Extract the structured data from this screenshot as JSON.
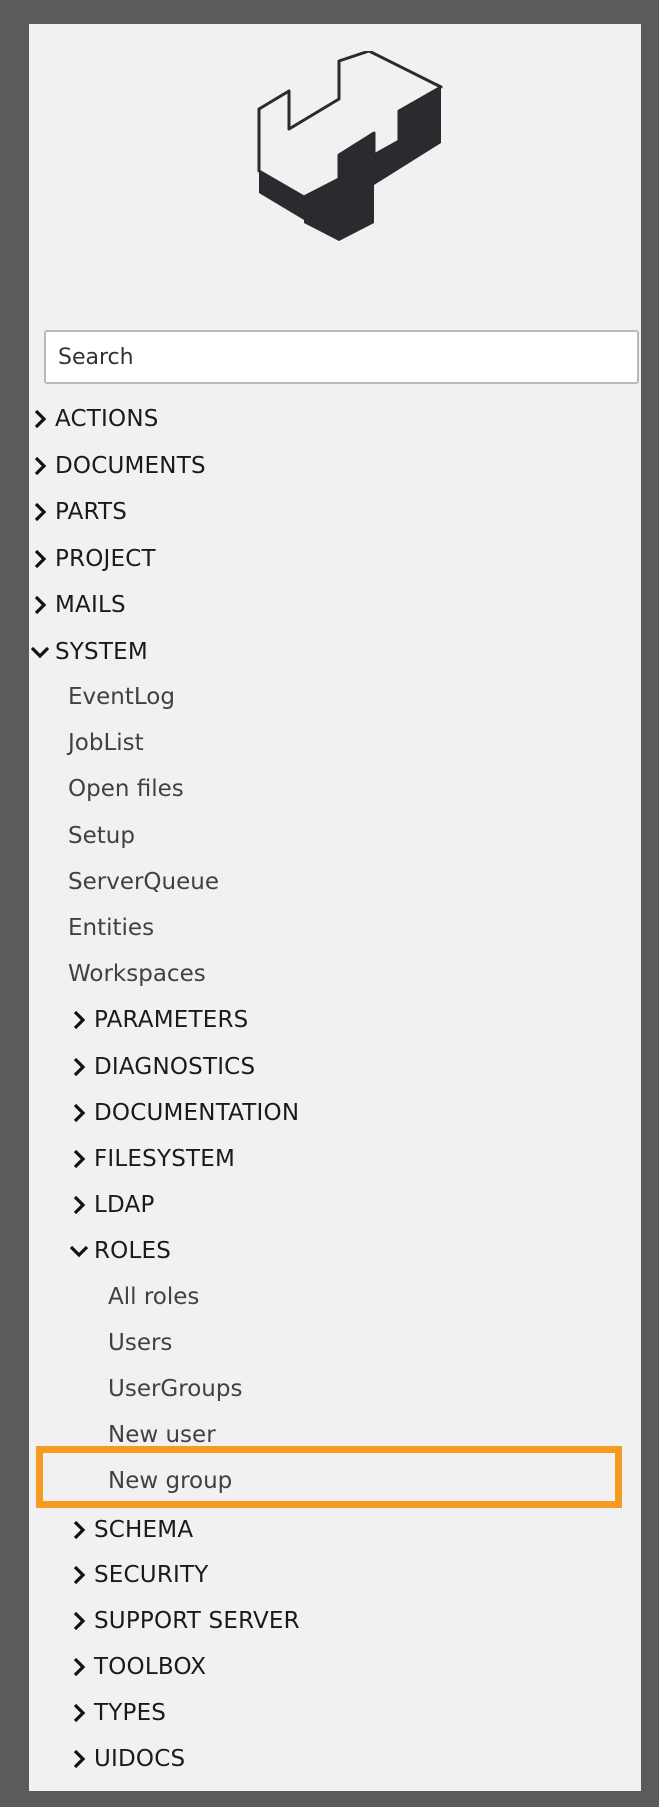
{
  "search": {
    "placeholder": "Search",
    "value": ""
  },
  "tree": {
    "actions": "ACTIONS",
    "documents": "DOCUMENTS",
    "parts": "PARTS",
    "project": "PROJECT",
    "mails": "MAILS",
    "system": {
      "label": "SYSTEM",
      "leaves": {
        "eventlog": "EventLog",
        "joblist": "JobList",
        "openfiles": "Open files",
        "setup": "Setup",
        "serverqueue": "ServerQueue",
        "entities": "Entities",
        "workspaces": "Workspaces"
      },
      "folders": {
        "parameters": "PARAMETERS",
        "diagnostics": "DIAGNOSTICS",
        "documentation": "DOCUMENTATION",
        "filesystem": "FILESYSTEM",
        "ldap": "LDAP",
        "roles": {
          "label": "ROLES",
          "items": {
            "allroles": "All roles",
            "users": "Users",
            "usergroups": "UserGroups",
            "newuser": "New user",
            "newgroup": "New group"
          }
        },
        "schema": "SCHEMA",
        "security": "SECURITY",
        "supportserver": "SUPPORT SERVER",
        "toolbox": "TOOLBOX",
        "types": "TYPES",
        "uidocs": "UIDOCS"
      }
    }
  },
  "icons": {
    "logo": "h-block-logo-icon",
    "collapsed": "chevron-right-icon",
    "expanded": "chevron-down-icon"
  },
  "colors": {
    "background": "#5b5b5b",
    "panel": "#f1f1f1",
    "highlight": "#f59b22",
    "logo_dark": "#2b2b2f"
  }
}
